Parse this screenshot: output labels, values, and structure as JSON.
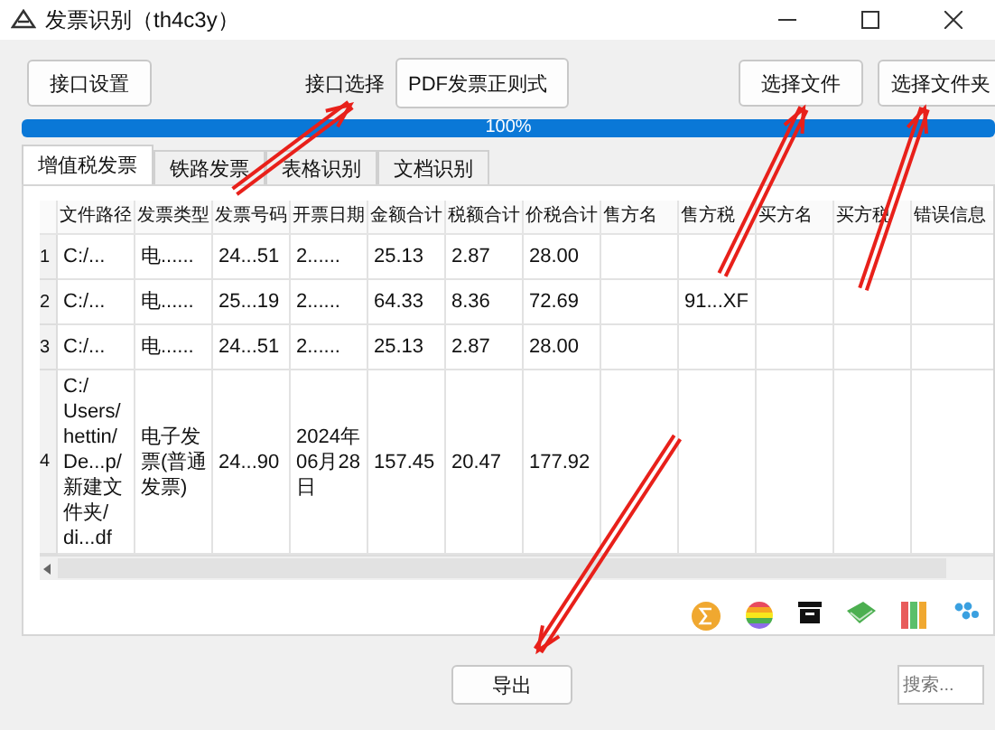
{
  "window": {
    "title": "发票识别（th4c3y）"
  },
  "toolbar": {
    "settings_button": "接口设置",
    "interface_label": "接口选择",
    "interface_value": "PDF发票正则式",
    "select_file_button": "选择文件",
    "select_folder_button": "选择文件夹"
  },
  "progress": {
    "level": 1,
    "reading": "100%"
  },
  "tabs": [
    {
      "label": "增值税发票",
      "selected": true
    },
    {
      "label": "铁路发票",
      "selected": false
    },
    {
      "label": "表格识别",
      "selected": false
    },
    {
      "label": "文档识别",
      "selected": false
    }
  ],
  "table": {
    "columns": [
      "文件路径",
      "发票类型",
      "发票号码",
      "开票日期",
      "金额合计",
      "税额合计",
      "价税合计",
      "售方名",
      "售方税",
      "买方名",
      "买方税",
      "错误信息"
    ],
    "rows": [
      {
        "number": "1",
        "cells": [
          "C:/...",
          "电......",
          "24...51",
          "2......",
          "25.13",
          "2.87",
          "28.00",
          null,
          null,
          null,
          null,
          null
        ]
      },
      {
        "number": "2",
        "cells": [
          "C:/...",
          "电......",
          "25...19",
          "2......",
          "64.33",
          "8.36",
          "72.69",
          null,
          "91...XF",
          null,
          null,
          null
        ]
      },
      {
        "number": "3",
        "cells": [
          "C:/...",
          "电......",
          "24...51",
          "2......",
          "25.13",
          "2.87",
          "28.00",
          null,
          null,
          null,
          null,
          null
        ]
      },
      {
        "number": "4",
        "cells": [
          "C:/\nUsers/\nhettin/\nDe...p/\n新建文件夹/\ndi...df",
          "电子发票(普通发票)",
          "24...90",
          "2024年\n06月28\n日",
          "157.45",
          "20.47",
          "177.92",
          null,
          null,
          null,
          null,
          null
        ]
      }
    ]
  },
  "footer": {
    "export_button": "导出",
    "search": {
      "placeholder": "搜索..."
    }
  }
}
